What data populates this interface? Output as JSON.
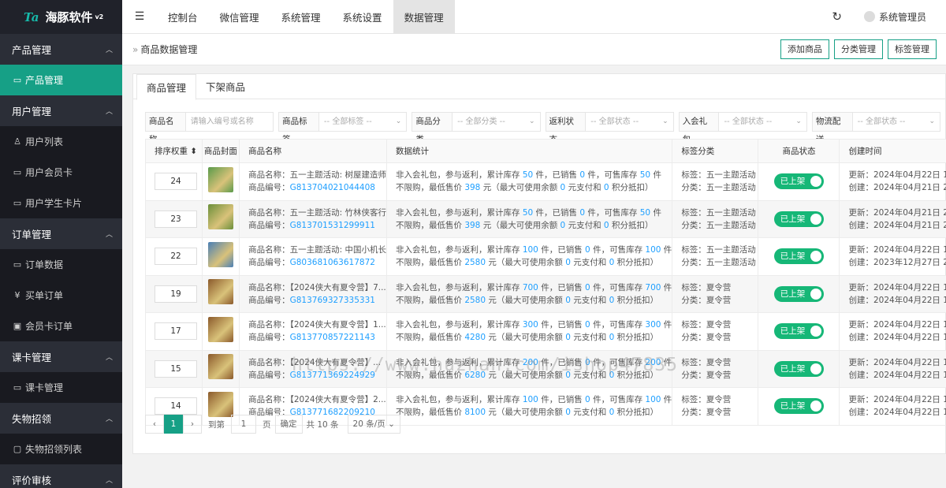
{
  "brand": {
    "mark": "Ta",
    "name": "海豚软件",
    "version": "v2"
  },
  "sidebar": {
    "groups": [
      {
        "label": "产品管理",
        "items": [
          {
            "label": "产品管理",
            "icon": "card-icon",
            "glyph": "▭",
            "active": true
          }
        ]
      },
      {
        "label": "用户管理",
        "items": [
          {
            "label": "用户列表",
            "icon": "user-icon",
            "glyph": "♙"
          },
          {
            "label": "用户会员卡",
            "icon": "card-icon",
            "glyph": "▭"
          },
          {
            "label": "用户学生卡片",
            "icon": "card-icon",
            "glyph": "▭"
          }
        ]
      },
      {
        "label": "订单管理",
        "items": [
          {
            "label": "订单数据",
            "icon": "folder-icon",
            "glyph": "▭"
          },
          {
            "label": "买单订单",
            "icon": "yen-icon",
            "glyph": "¥"
          },
          {
            "label": "会员卡订单",
            "icon": "gift-icon",
            "glyph": "▣"
          }
        ]
      },
      {
        "label": "课卡管理",
        "items": [
          {
            "label": "课卡管理",
            "icon": "card-icon",
            "glyph": "▭"
          }
        ]
      },
      {
        "label": "失物招领",
        "items": [
          {
            "label": "失物招领列表",
            "icon": "lock-icon",
            "glyph": "▢"
          }
        ]
      },
      {
        "label": "评价审核",
        "items": []
      }
    ]
  },
  "topnav": {
    "items": [
      "控制台",
      "微信管理",
      "系统管理",
      "系统设置",
      "数据管理"
    ],
    "active": 4,
    "user": "系统管理员"
  },
  "page": {
    "title": "商品数据管理",
    "buttons": [
      "添加商品",
      "分类管理",
      "标签管理"
    ]
  },
  "tabs": [
    "商品管理",
    "下架商品"
  ],
  "filters": [
    {
      "label": "商品名称",
      "placeholder": "请输入编号或名称",
      "select": false
    },
    {
      "label": "商品标签",
      "placeholder": "-- 全部标签 --",
      "select": true
    },
    {
      "label": "商品分类",
      "placeholder": "-- 全部分类 --",
      "select": true
    },
    {
      "label": "返利状态",
      "placeholder": "-- 全部状态 --",
      "select": true
    },
    {
      "label": "入会礼包",
      "placeholder": "-- 全部状态 --",
      "select": true
    },
    {
      "label": "物流配送",
      "placeholder": "-- 全部状态 --",
      "select": true
    }
  ],
  "table": {
    "headers": [
      "排序权重",
      "商品封面",
      "商品名称",
      "数据统计",
      "标签分类",
      "商品状态",
      "创建时间"
    ],
    "rows": [
      {
        "sort": "24",
        "name": "五一主题活动: 树屋建造师",
        "code": "G813704021044408",
        "stock": "50",
        "sold": "0",
        "avail": "50",
        "price": "398",
        "tag": "五一主题活动",
        "cat": "五一主题活动",
        "status": "已上架",
        "updated": "2024年04月22日 1",
        "created": "2024年04月21日 2",
        "img": "#5a9a4a"
      },
      {
        "sort": "23",
        "name": "五一主题活动: 竹林侠客行",
        "code": "G813701531299911",
        "stock": "50",
        "sold": "0",
        "avail": "50",
        "price": "398",
        "tag": "五一主题活动",
        "cat": "五一主题活动",
        "status": "已上架",
        "updated": "2024年04月21日 2",
        "created": "2024年04月21日 2",
        "img": "#6b8f3a"
      },
      {
        "sort": "22",
        "name": "五一主题活动: 中国小机长",
        "code": "G803681063617872",
        "stock": "100",
        "sold": "0",
        "avail": "100",
        "price": "2580",
        "tag": "五一主题活动",
        "cat": "五一主题活动",
        "status": "已上架",
        "updated": "2024年04月22日 1",
        "created": "2023年12月27日 2",
        "img": "#4a7fb5"
      },
      {
        "sort": "19",
        "name": "【2024侠大有夏令营】7...",
        "code": "G813769327335331",
        "stock": "700",
        "sold": "0",
        "avail": "700",
        "price": "2580",
        "tag": "夏令营",
        "cat": "夏令营",
        "status": "已上架",
        "updated": "2024年04月22日 1",
        "created": "2024年04月22日 1",
        "img": "#8b5a2b"
      },
      {
        "sort": "17",
        "name": "【2024侠大有夏令营】1...",
        "code": "G813770857221143",
        "stock": "300",
        "sold": "0",
        "avail": "300",
        "price": "4280",
        "tag": "夏令营",
        "cat": "夏令营",
        "status": "已上架",
        "updated": "2024年04月22日 1",
        "created": "2024年04月22日 1",
        "img": "#8b5a2b"
      },
      {
        "sort": "15",
        "name": "【2024侠大有夏令营】...",
        "code": "G813771369224929",
        "stock": "200",
        "sold": "0",
        "avail": "200",
        "price": "6280",
        "tag": "夏令营",
        "cat": "夏令营",
        "status": "已上架",
        "updated": "2024年04月22日 1",
        "created": "2024年04月22日 1",
        "img": "#8b5a2b"
      },
      {
        "sort": "14",
        "name": "【2024侠大有夏令营】2...",
        "code": "G813771682209210",
        "stock": "100",
        "sold": "0",
        "avail": "100",
        "price": "8100",
        "tag": "夏令营",
        "cat": "夏令营",
        "status": "已上架",
        "updated": "2024年04月22日 1",
        "created": "2024年04月22日 1",
        "img": "#8b5a2b"
      }
    ]
  },
  "pagination": {
    "current": "1",
    "goto_label": "到第",
    "goto_value": "1",
    "page_unit": "页",
    "confirm": "确定",
    "total": "共 10 条",
    "page_size": "20 条/页"
  },
  "watermark": "https://www.huzhan.com/ishop47835"
}
